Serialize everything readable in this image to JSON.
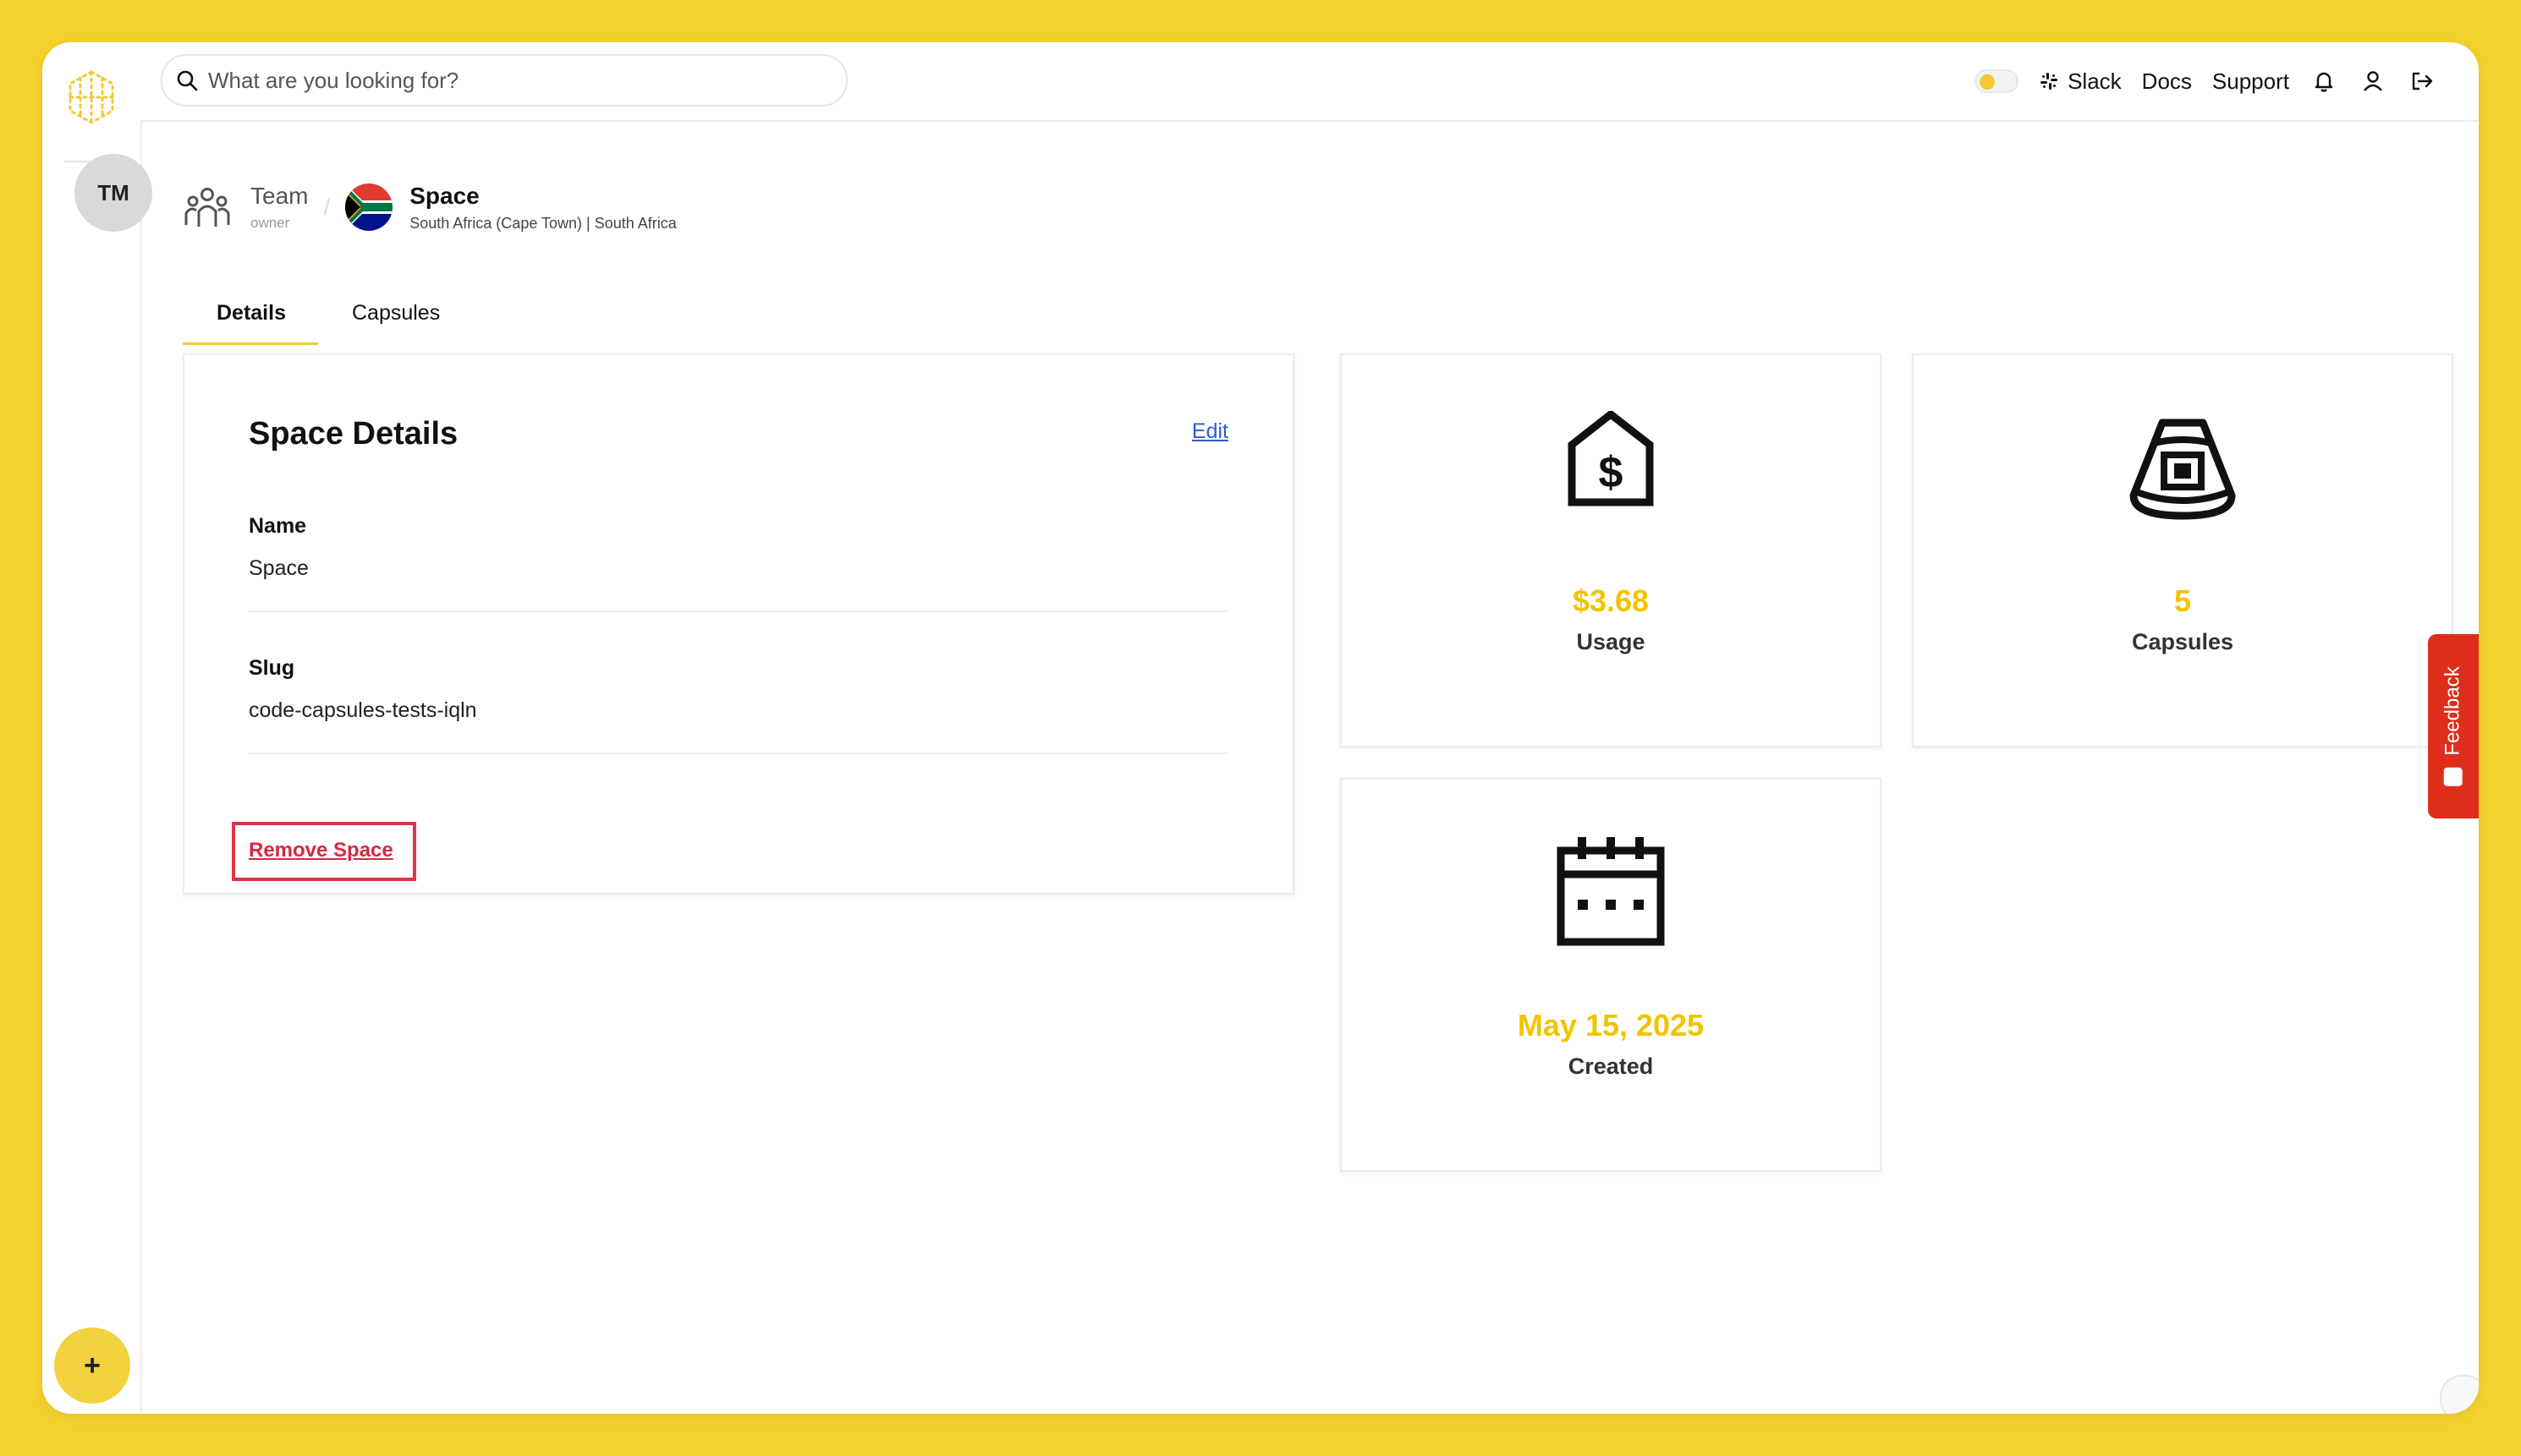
{
  "search": {
    "placeholder": "What are you looking for?"
  },
  "topnav": {
    "slack": "Slack",
    "docs": "Docs",
    "support": "Support"
  },
  "sidebar": {
    "team_initials": "TM",
    "add_label": "+"
  },
  "breadcrumb": {
    "team_name": "Team",
    "team_role": "owner",
    "space_name": "Space",
    "space_region": "South Africa (Cape Town) | South Africa"
  },
  "tabs": [
    {
      "label": "Details",
      "active": true
    },
    {
      "label": "Capsules",
      "active": false
    }
  ],
  "details": {
    "title": "Space Details",
    "edit_label": "Edit",
    "name_label": "Name",
    "name_value": "Space",
    "slug_label": "Slug",
    "slug_value": "code-capsules-tests-iqln",
    "remove_label": "Remove Space"
  },
  "stats": {
    "usage": {
      "value": "$3.68",
      "label": "Usage",
      "icon": "price-tag-icon"
    },
    "capsules": {
      "value": "5",
      "label": "Capsules",
      "icon": "capsule-icon"
    },
    "created": {
      "value": "May 15, 2025",
      "label": "Created",
      "icon": "calendar-icon"
    }
  },
  "feedback": {
    "label": "Feedback"
  },
  "colors": {
    "accent": "#F2C400",
    "danger": "#D42A40",
    "background": "#F4D22E",
    "feedback": "#DE2E1B"
  }
}
